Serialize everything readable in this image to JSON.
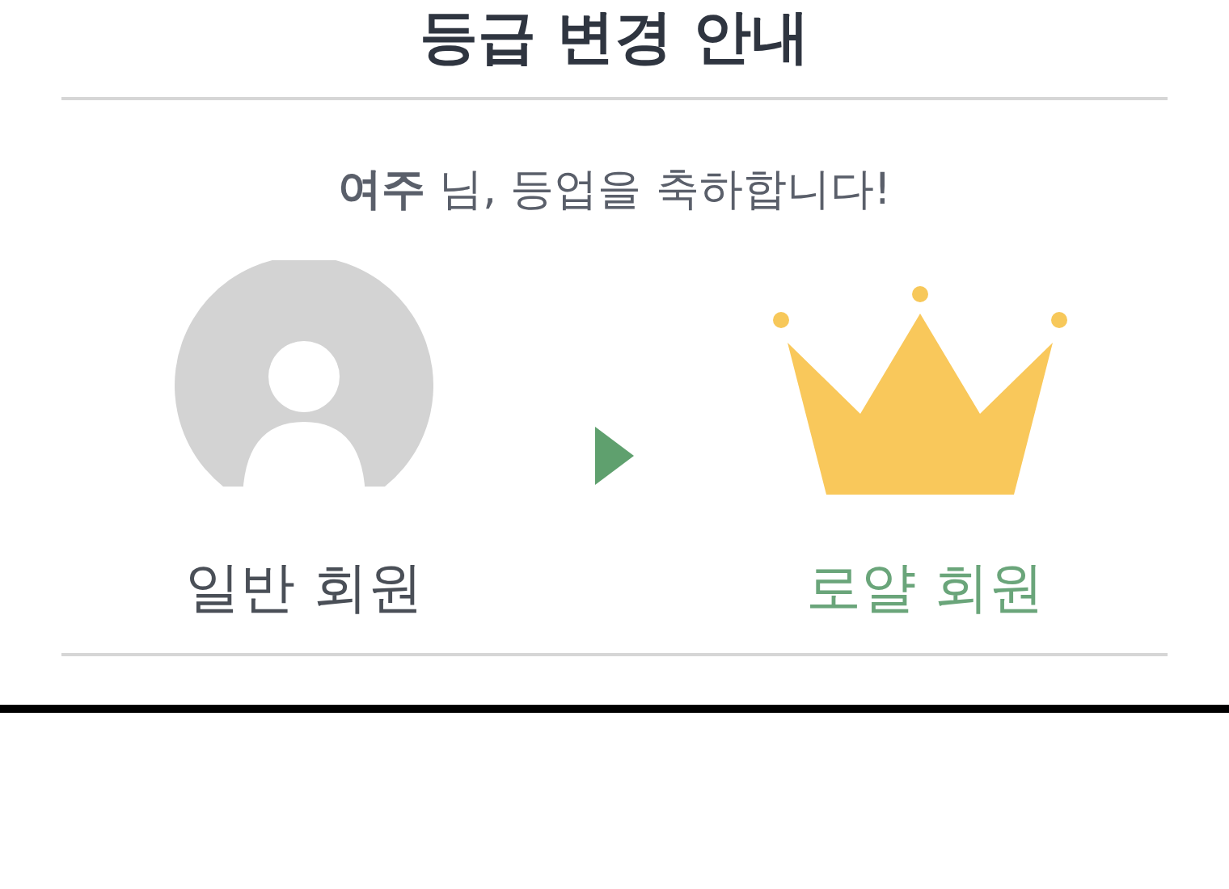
{
  "title": "등급 변경 안내",
  "message": "**여주** 님, 등업을 축하합니다!",
  "tiers": [
    {
      "kind": "avatar",
      "label": "일반 회원",
      "color": "#4a4f57"
    },
    {
      "kind": "crown",
      "label": "로얄 회원",
      "color": "#6aa57a"
    }
  ]
}
